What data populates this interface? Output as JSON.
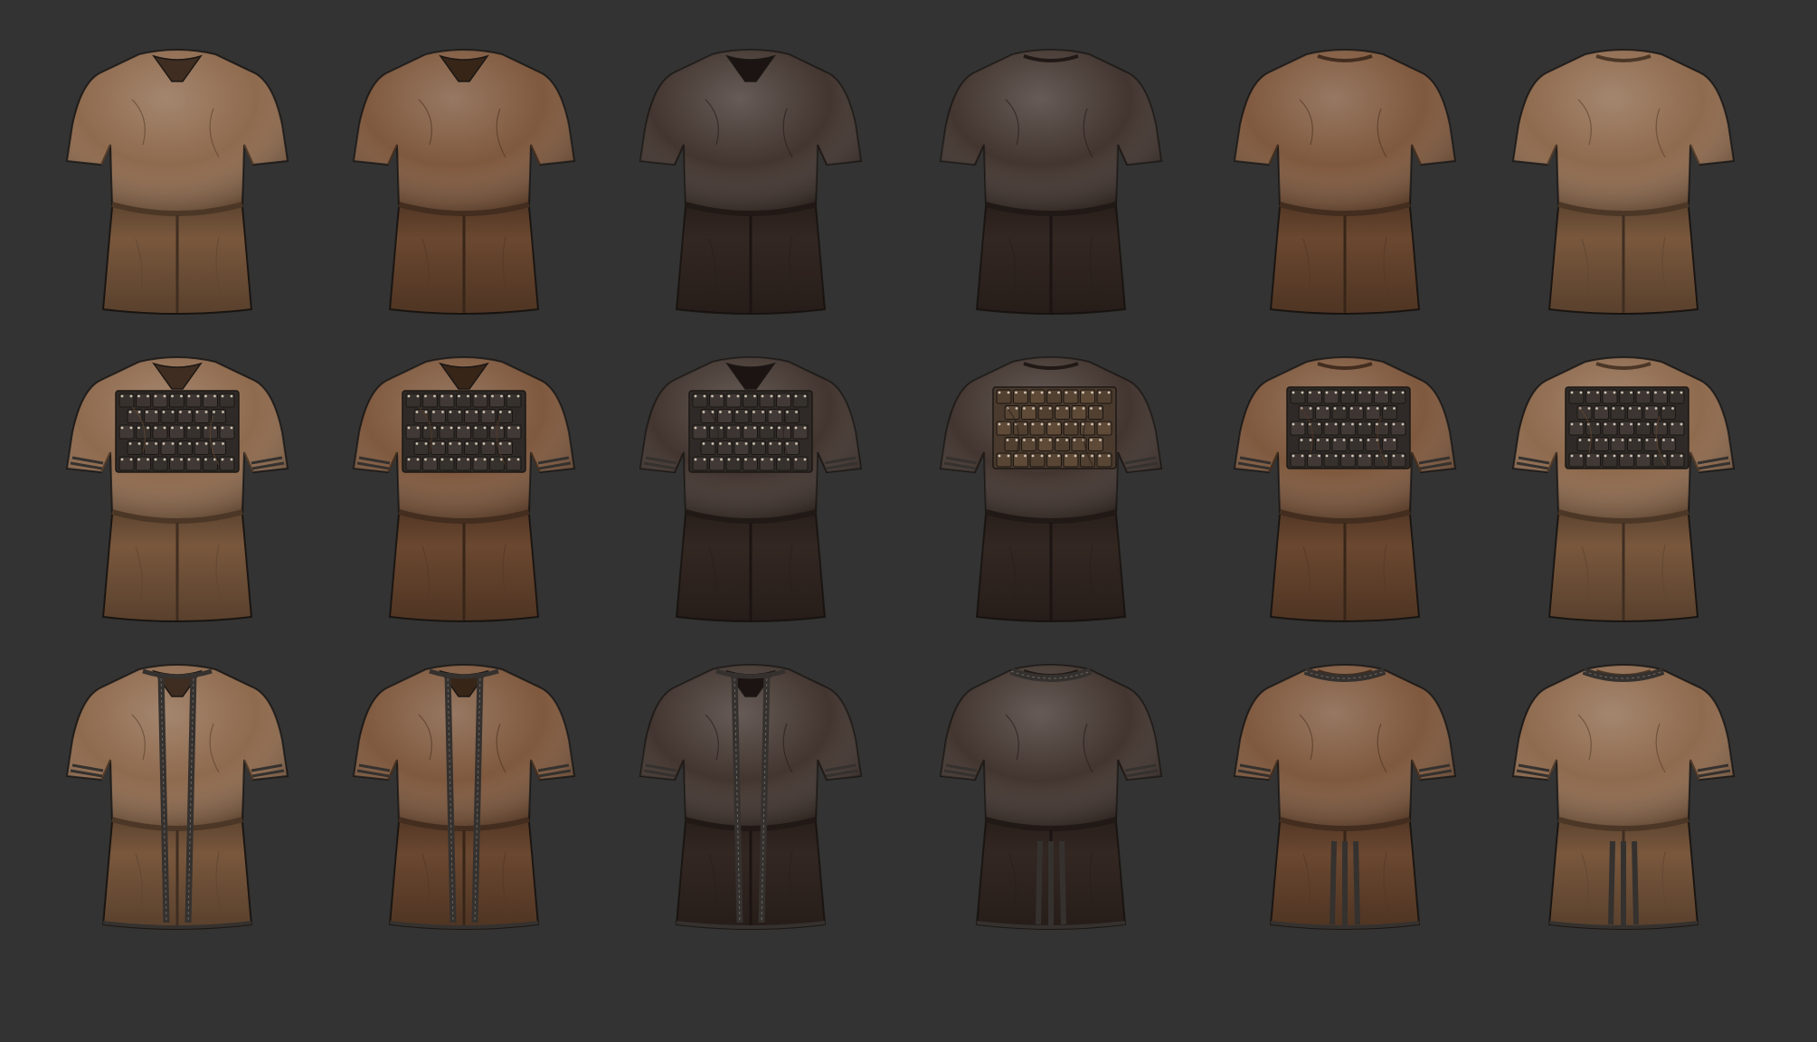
{
  "background_color": "#333333",
  "grid": {
    "rows": 3,
    "columns": 6
  },
  "palette": {
    "light_brown": "#8a6446",
    "mid_brown": "#7a5236",
    "dark_brown": "#3b2d27",
    "outline": "#1c1714",
    "plate": "#2f2a27",
    "rivet": "#cfc4b5",
    "trim": "#35312f"
  },
  "rows": [
    {
      "variant": "plain tunic",
      "items": [
        {
          "view": "front",
          "color": "light_brown"
        },
        {
          "view": "front",
          "color": "mid_brown"
        },
        {
          "view": "front",
          "color": "dark_brown"
        },
        {
          "view": "back",
          "color": "dark_brown"
        },
        {
          "view": "back",
          "color": "mid_brown"
        },
        {
          "view": "back",
          "color": "light_brown"
        }
      ]
    },
    {
      "variant": "tunic with riveted plates",
      "items": [
        {
          "view": "front",
          "color": "light_brown"
        },
        {
          "view": "front",
          "color": "mid_brown"
        },
        {
          "view": "front",
          "color": "dark_brown"
        },
        {
          "view": "back",
          "color": "dark_brown"
        },
        {
          "view": "back",
          "color": "mid_brown"
        },
        {
          "view": "back",
          "color": "light_brown"
        }
      ]
    },
    {
      "variant": "tunic with stitched trim",
      "items": [
        {
          "view": "front",
          "color": "light_brown"
        },
        {
          "view": "front",
          "color": "mid_brown"
        },
        {
          "view": "front",
          "color": "dark_brown"
        },
        {
          "view": "back",
          "color": "dark_brown"
        },
        {
          "view": "back",
          "color": "mid_brown"
        },
        {
          "view": "back",
          "color": "light_brown"
        }
      ]
    }
  ]
}
